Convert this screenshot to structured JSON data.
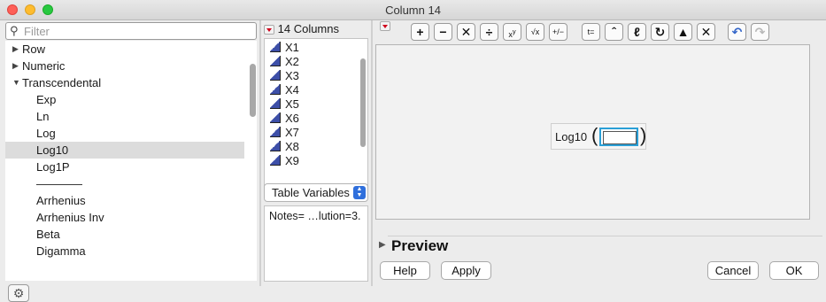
{
  "window": {
    "title": "Column 14"
  },
  "filter": {
    "placeholder": "Filter"
  },
  "functions": [
    {
      "label": "Row",
      "type": "category",
      "expanded": false
    },
    {
      "label": "Numeric",
      "type": "category",
      "expanded": false
    },
    {
      "label": "Transcendental",
      "type": "category",
      "expanded": true
    },
    {
      "label": "Exp",
      "type": "leaf"
    },
    {
      "label": "Ln",
      "type": "leaf"
    },
    {
      "label": "Log",
      "type": "leaf"
    },
    {
      "label": "Log10",
      "type": "leaf",
      "selected": true
    },
    {
      "label": "Log1P",
      "type": "leaf"
    },
    {
      "label": "————",
      "type": "leaf"
    },
    {
      "label": "Arrhenius",
      "type": "leaf"
    },
    {
      "label": "Arrhenius Inv",
      "type": "leaf"
    },
    {
      "label": "Beta",
      "type": "leaf"
    },
    {
      "label": "Digamma",
      "type": "leaf"
    }
  ],
  "columns": {
    "header": "14 Columns",
    "items": [
      "X1",
      "X2",
      "X3",
      "X4",
      "X5",
      "X6",
      "X7",
      "X8",
      "X9"
    ]
  },
  "table_variables": {
    "selected": "Table Variables",
    "content": "Notes= …lution=3."
  },
  "toolbar": {
    "icons": [
      "add-icon",
      "subtract-icon",
      "multiply-icon",
      "divide-icon",
      "power-icon",
      "root-icon",
      "plus-minus-icon",
      "assign-icon",
      "caret-icon",
      "local-variable-icon",
      "swap-icon",
      "peel-icon",
      "delete-icon",
      "undo-icon",
      "redo-icon"
    ]
  },
  "formula": {
    "function": "Log10"
  },
  "preview": {
    "label": "Preview"
  },
  "buttons": {
    "help": "Help",
    "apply": "Apply",
    "cancel": "Cancel",
    "ok": "OK"
  },
  "colors": {
    "selection": "#dcdcdc",
    "accent": "#2a9fd6",
    "stepper": "#2f6fdc",
    "menu_triangle": "#d0021b"
  }
}
